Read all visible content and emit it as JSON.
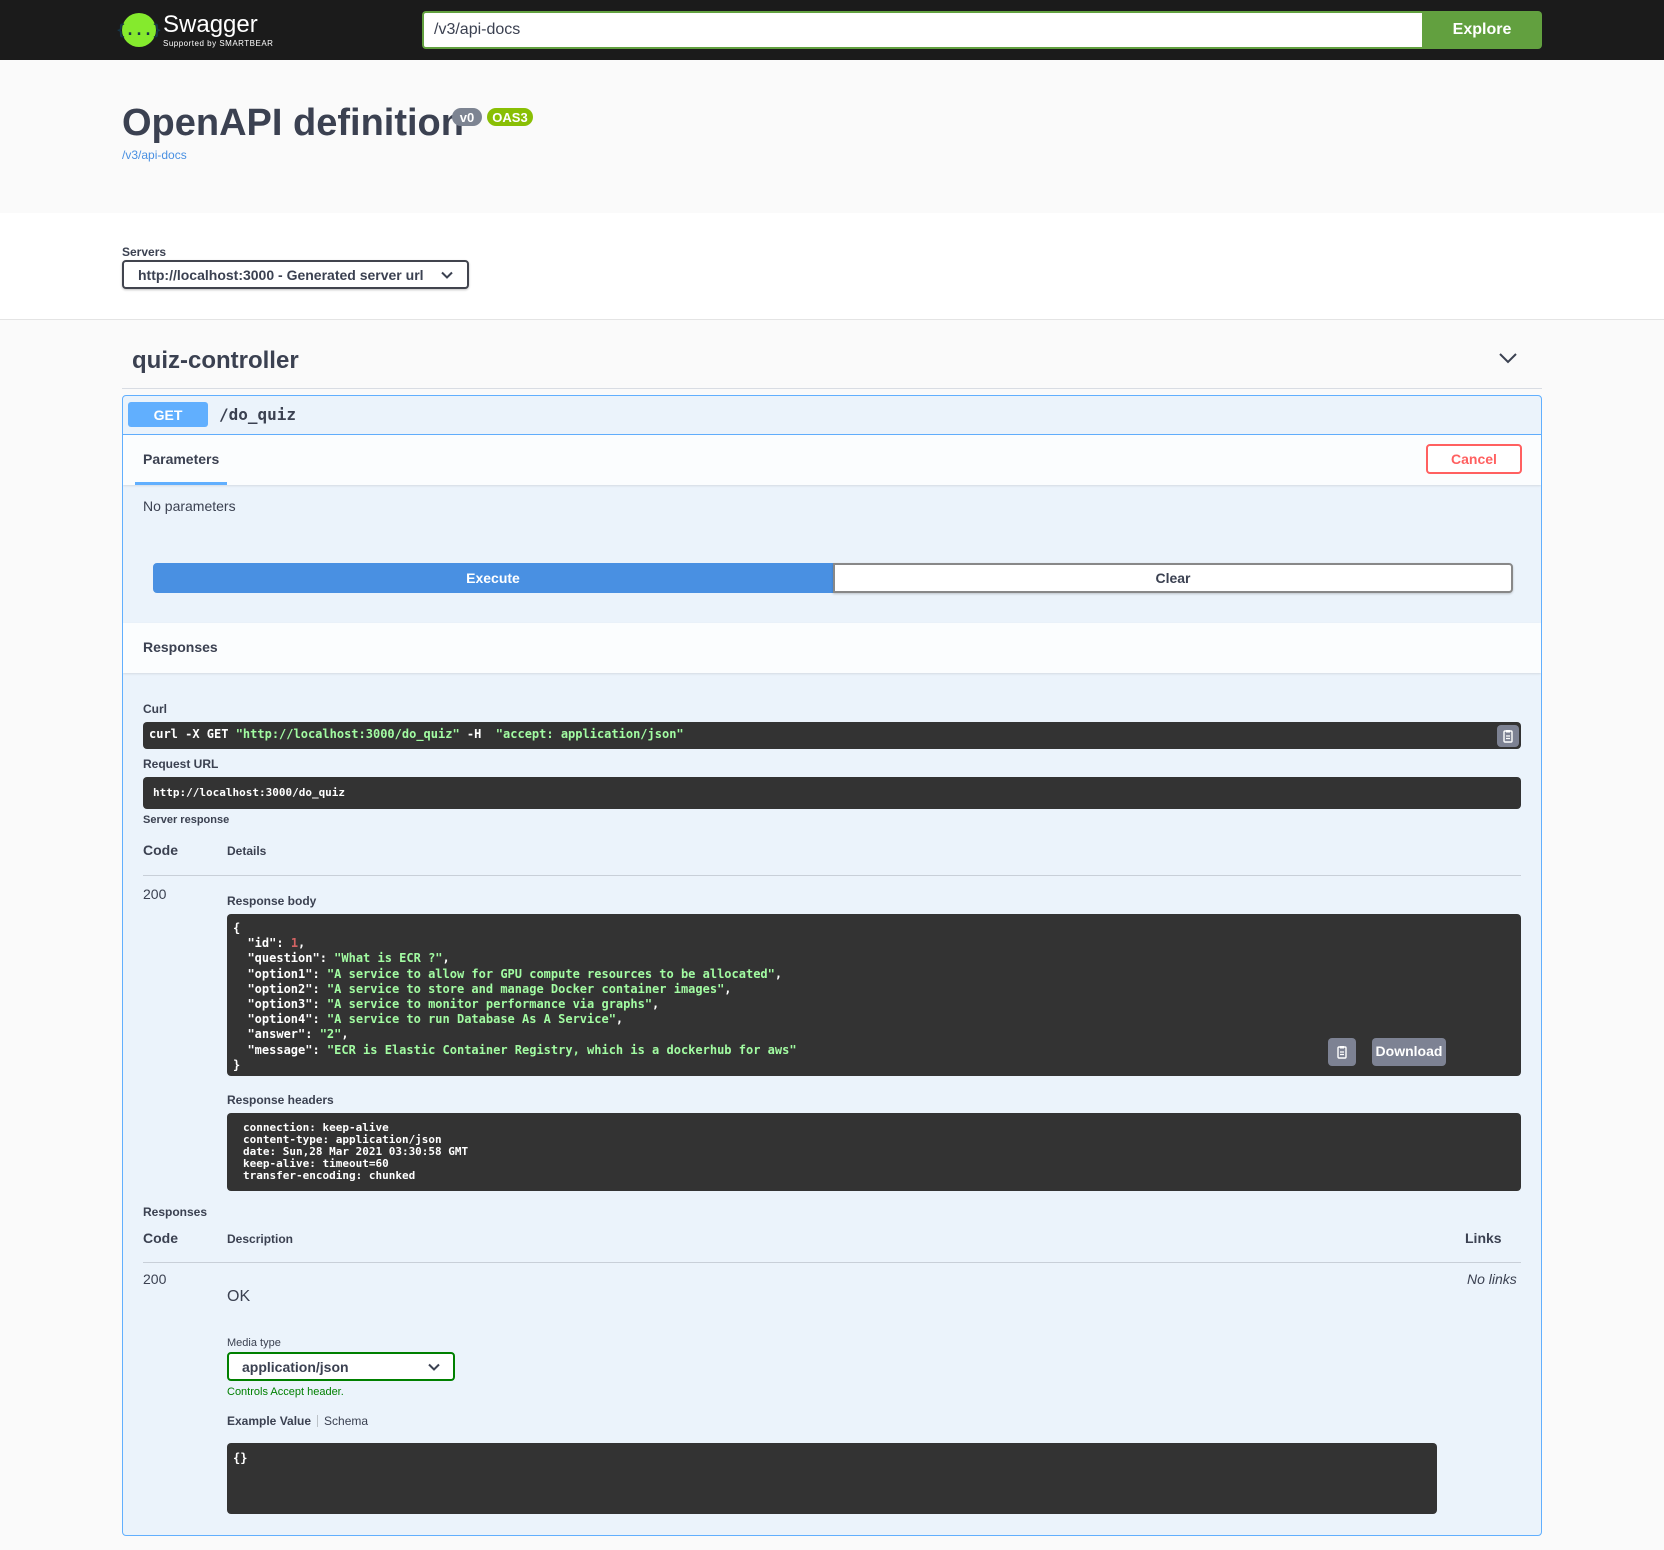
{
  "topbar": {
    "brand": "Swagger",
    "brand_sub": "Supported by SMARTBEAR",
    "logo_glyph": "{...}",
    "url_value": "/v3/api-docs",
    "explore_label": "Explore"
  },
  "info": {
    "title": "OpenAPI definition",
    "version_badge": "v0",
    "oas_badge": "OAS3",
    "spec_link": "/v3/api-docs"
  },
  "servers": {
    "label": "Servers",
    "selected": "http://localhost:3000 - Generated server url"
  },
  "tag": {
    "name": "quiz-controller"
  },
  "operation": {
    "method": "GET",
    "path": "/do_quiz",
    "params_tab": "Parameters",
    "cancel_label": "Cancel",
    "no_params": "No parameters",
    "execute_label": "Execute",
    "clear_label": "Clear",
    "responses_title": "Responses",
    "curl_label": "Curl",
    "curl_prefix": "curl -X GET ",
    "curl_url": "\"http://localhost:3000/do_quiz\"",
    "curl_mid": " -H  ",
    "curl_header": "\"accept: application/json\"",
    "request_url_label": "Request URL",
    "request_url": "http://localhost:3000/do_quiz",
    "server_response_label": "Server response",
    "code_head": "Code",
    "details_head": "Details",
    "response_code": "200",
    "response_body_label": "Response body",
    "response_body": {
      "open": "{",
      "close": "}",
      "id_key": "\"id\"",
      "id_val": "1",
      "question_key": "\"question\"",
      "question_val": "\"What is ECR ?\"",
      "option1_key": "\"option1\"",
      "option1_val": "\"A service to allow for GPU compute resources to be allocated\"",
      "option2_key": "\"option2\"",
      "option2_val": "\"A service to store and manage Docker container images\"",
      "option3_key": "\"option3\"",
      "option3_val": "\"A service to monitor performance via graphs\"",
      "option4_key": "\"option4\"",
      "option4_val": "\"A service to run Database As A Service\"",
      "answer_key": "\"answer\"",
      "answer_val": "\"2\"",
      "message_key": "\"message\"",
      "message_val": "\"ECR is Elastic Container Registry, which is a dockerhub for aws\""
    },
    "download_label": "Download",
    "response_headers_label": "Response headers",
    "response_headers": [
      "connection: keep-alive",
      "content-type: application/json",
      "date: Sun,28 Mar 2021 03:30:58 GMT",
      "keep-alive: timeout=60",
      "transfer-encoding: chunked"
    ],
    "responses_label": "Responses",
    "description_head": "Description",
    "links_head": "Links",
    "doc_code": "200",
    "doc_description": "OK",
    "no_links": "No links",
    "media_type_label": "Media type",
    "media_type_value": "application/json",
    "controls_accept": "Controls Accept header.",
    "example_value_tab": "Example Value",
    "schema_tab": "Schema",
    "example_body": "{}"
  },
  "colors": {
    "get": "#61affe",
    "explore": "#62a03f",
    "cancel": "#ff6060",
    "execute": "#4990e2",
    "code_bg": "#333333",
    "json_string": "#a2fca2",
    "json_number": "#d36363"
  }
}
